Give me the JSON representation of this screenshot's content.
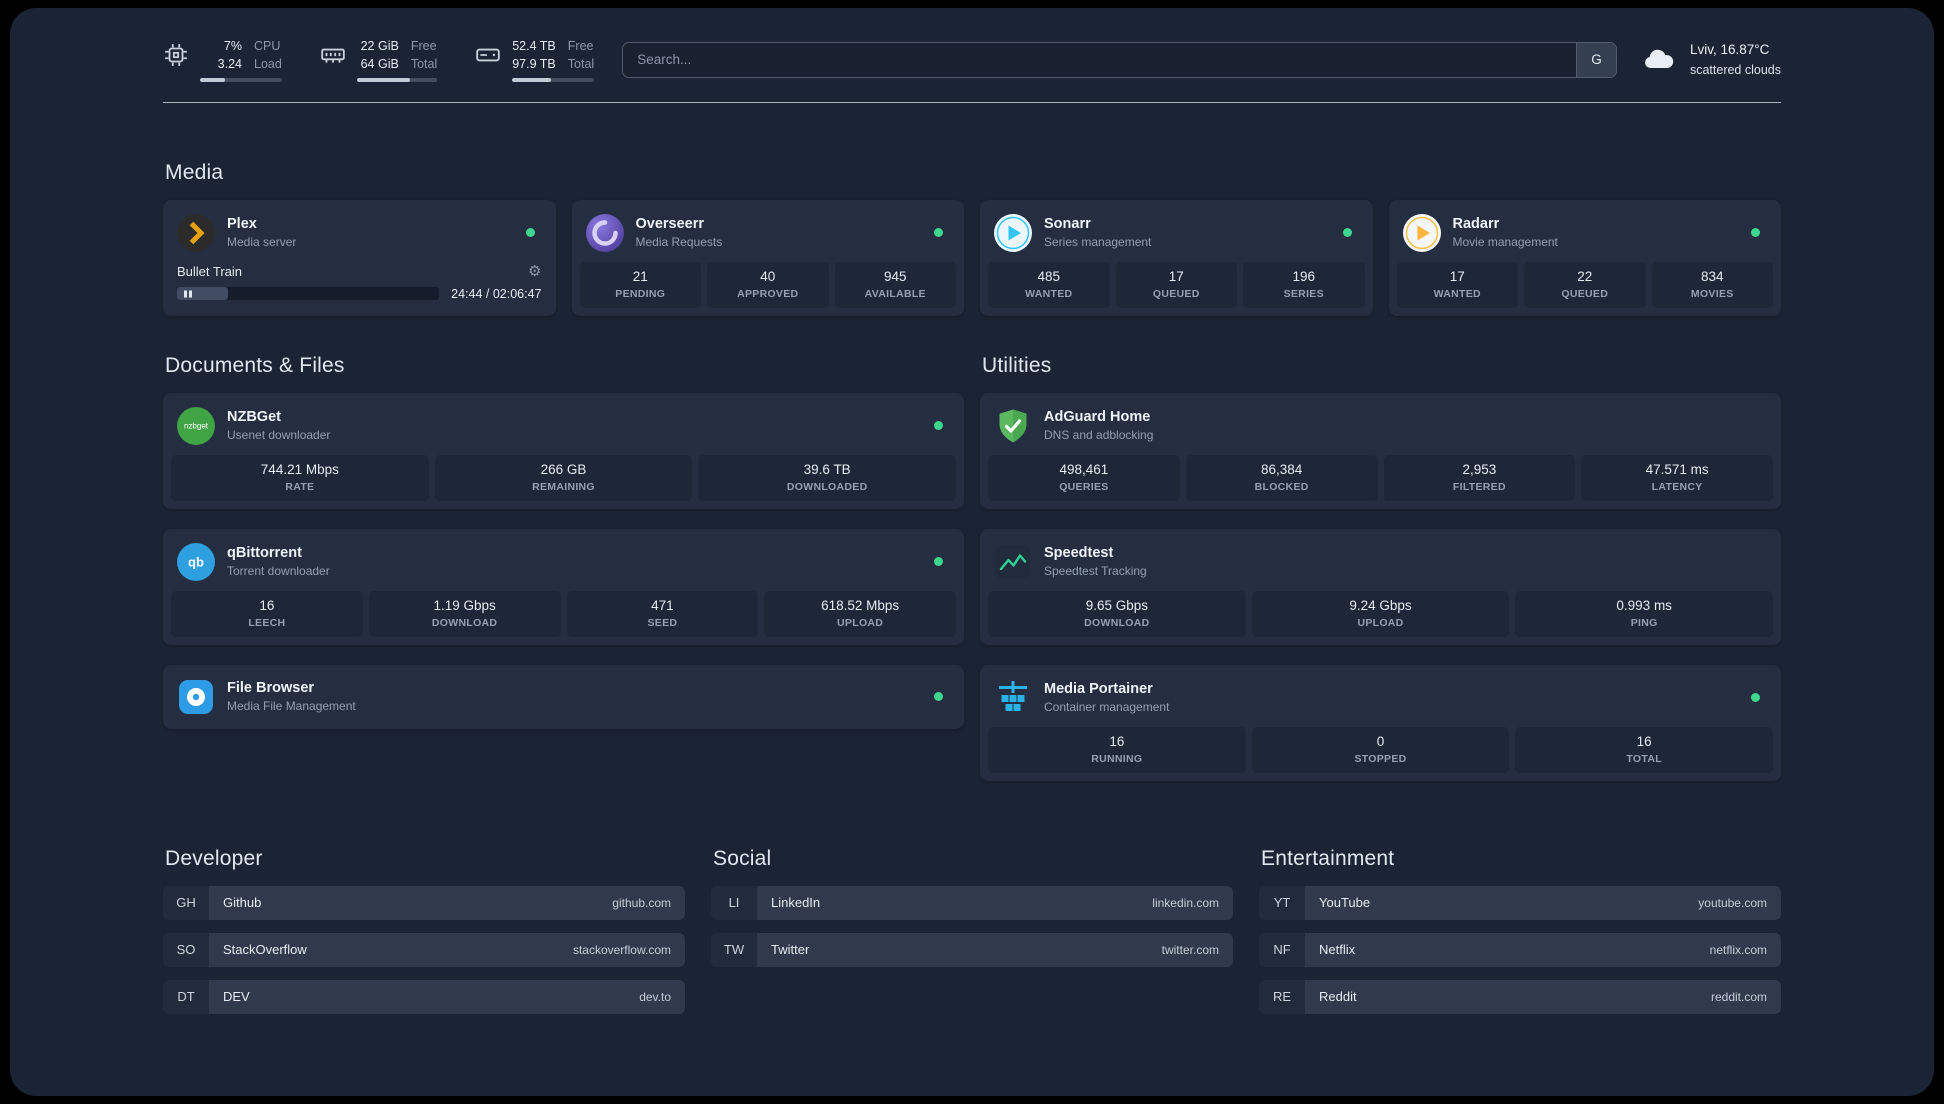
{
  "topbar": {
    "cpu": {
      "icon": "cpu-chip-icon",
      "value_top": "7%",
      "value_bottom": "3.24",
      "label_top": "CPU",
      "label_bottom": "Load",
      "bar_pct": 30
    },
    "ram": {
      "icon": "memory-icon",
      "value_top": "22 GiB",
      "value_bottom": "64 GiB",
      "label_top": "Free",
      "label_bottom": "Total",
      "bar_pct": 66
    },
    "disk": {
      "icon": "disk-icon",
      "value_top": "52.4 TB",
      "value_bottom": "97.9 TB",
      "label_top": "Free",
      "label_bottom": "Total",
      "bar_pct": 47
    },
    "search": {
      "placeholder": "Search...",
      "button_label": "G"
    },
    "weather": {
      "icon": "cloud-icon",
      "location": "Lviv, 16.87°C",
      "condition": "scattered clouds"
    }
  },
  "media": {
    "heading": "Media",
    "plex": {
      "icon": "plex-icon",
      "title": "Plex",
      "subtitle": "Media server",
      "online": true,
      "now_playing": "Bullet Train",
      "time": "24:44 / 02:06:47",
      "progress_pct": 19.5
    },
    "cards": [
      {
        "icon": "overseerr-icon",
        "title": "Overseerr",
        "subtitle": "Media Requests",
        "online": true,
        "stats": [
          {
            "value": "21",
            "label": "PENDING"
          },
          {
            "value": "40",
            "label": "APPROVED"
          },
          {
            "value": "945",
            "label": "AVAILABLE"
          }
        ]
      },
      {
        "icon": "sonarr-icon",
        "title": "Sonarr",
        "subtitle": "Series management",
        "online": true,
        "stats": [
          {
            "value": "485",
            "label": "WANTED"
          },
          {
            "value": "17",
            "label": "QUEUED"
          },
          {
            "value": "196",
            "label": "SERIES"
          }
        ]
      },
      {
        "icon": "radarr-icon",
        "title": "Radarr",
        "subtitle": "Movie management",
        "online": true,
        "stats": [
          {
            "value": "17",
            "label": "WANTED"
          },
          {
            "value": "22",
            "label": "QUEUED"
          },
          {
            "value": "834",
            "label": "MOVIES"
          }
        ]
      }
    ]
  },
  "documents": {
    "heading": "Documents & Files",
    "cards": [
      {
        "icon": "nzbget-icon",
        "title": "NZBGet",
        "subtitle": "Usenet downloader",
        "online": true,
        "stats": [
          {
            "value": "744.21 Mbps",
            "label": "RATE"
          },
          {
            "value": "266 GB",
            "label": "REMAINING"
          },
          {
            "value": "39.6 TB",
            "label": "DOWNLOADED"
          }
        ]
      },
      {
        "icon": "qbittorrent-icon",
        "title": "qBittorrent",
        "subtitle": "Torrent downloader",
        "online": true,
        "stats": [
          {
            "value": "16",
            "label": "LEECH"
          },
          {
            "value": "1.19 Gbps",
            "label": "DOWNLOAD"
          },
          {
            "value": "471",
            "label": "SEED"
          },
          {
            "value": "618.52 Mbps",
            "label": "UPLOAD"
          }
        ]
      },
      {
        "icon": "filebrowser-icon",
        "title": "File Browser",
        "subtitle": "Media File Management",
        "online": true,
        "stats": []
      }
    ]
  },
  "utilities": {
    "heading": "Utilities",
    "cards": [
      {
        "icon": "adguard-icon",
        "title": "AdGuard Home",
        "subtitle": "DNS and adblocking",
        "online": false,
        "stats": [
          {
            "value": "498,461",
            "label": "QUERIES"
          },
          {
            "value": "86,384",
            "label": "BLOCKED"
          },
          {
            "value": "2,953",
            "label": "FILTERED"
          },
          {
            "value": "47.571 ms",
            "label": "LATENCY"
          }
        ]
      },
      {
        "icon": "speedtest-icon",
        "title": "Speedtest",
        "subtitle": "Speedtest Tracking",
        "online": false,
        "stats": [
          {
            "value": "9.65 Gbps",
            "label": "DOWNLOAD"
          },
          {
            "value": "9.24 Gbps",
            "label": "UPLOAD"
          },
          {
            "value": "0.993 ms",
            "label": "PING"
          }
        ]
      },
      {
        "icon": "portainer-icon",
        "title": "Media Portainer",
        "subtitle": "Container management",
        "online": true,
        "stats": [
          {
            "value": "16",
            "label": "RUNNING"
          },
          {
            "value": "0",
            "label": "STOPPED"
          },
          {
            "value": "16",
            "label": "TOTAL"
          }
        ]
      }
    ]
  },
  "bookmarks": [
    {
      "heading": "Developer",
      "items": [
        {
          "abbr": "GH",
          "name": "Github",
          "domain": "github.com"
        },
        {
          "abbr": "SO",
          "name": "StackOverflow",
          "domain": "stackoverflow.com"
        },
        {
          "abbr": "DT",
          "name": "DEV",
          "domain": "dev.to"
        }
      ]
    },
    {
      "heading": "Social",
      "items": [
        {
          "abbr": "LI",
          "name": "LinkedIn",
          "domain": "linkedin.com"
        },
        {
          "abbr": "TW",
          "name": "Twitter",
          "domain": "twitter.com"
        }
      ]
    },
    {
      "heading": "Entertainment",
      "items": [
        {
          "abbr": "YT",
          "name": "YouTube",
          "domain": "youtube.com"
        },
        {
          "abbr": "NF",
          "name": "Netflix",
          "domain": "netflix.com"
        },
        {
          "abbr": "RE",
          "name": "Reddit",
          "domain": "reddit.com"
        }
      ]
    }
  ],
  "colors": {
    "background": "#1b2435",
    "card": "#242e40",
    "stat_tile": "#1e2737",
    "status_online": "#3fd68f",
    "plex_accent": "#e5a00d"
  }
}
